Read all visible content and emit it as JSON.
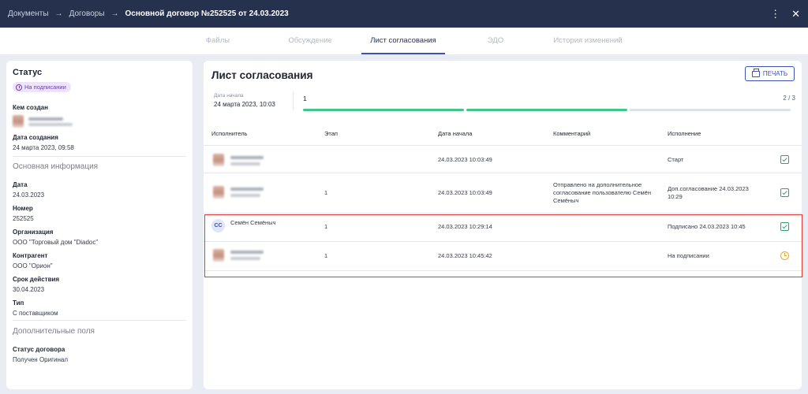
{
  "topbar": {
    "breadcrumbs": [
      "Документы",
      "Договоры"
    ],
    "current": "Основной договор №252525 от 24.03.2023",
    "separator": "→",
    "more_icon": "⋮",
    "close_icon": "✕"
  },
  "tabs": [
    "Файлы",
    "Обсуждение",
    "Лист согласования",
    "ЭДО",
    "История изменений"
  ],
  "active_tab": "Лист согласования",
  "left": {
    "status_title": "Статус",
    "status_badge": "На подписании",
    "created_by_label": "Кем создан",
    "created_date_label": "Дата создания",
    "created_date_value": "24 марта 2023, 09:58",
    "main_info_title": "Основная информация",
    "fields": [
      {
        "label": "Дата",
        "value": "24.03.2023"
      },
      {
        "label": "Номер",
        "value": "252525"
      },
      {
        "label": "Организация",
        "value": "ООО \"Торговый дом \"Diadoc\""
      },
      {
        "label": "Контрагент",
        "value": "ООО \"Орион\""
      },
      {
        "label": "Срок действия",
        "value": "30.04.2023"
      },
      {
        "label": "Тип",
        "value": "С поставщиком"
      }
    ],
    "extra_title": "Дополнительные поля",
    "extra_fields": [
      {
        "label": "Статус договора",
        "value": "Получен Оригинал"
      }
    ]
  },
  "sheet": {
    "title": "Лист согласования",
    "print_label": "ПЕЧАТЬ",
    "start_label": "Дата начала",
    "start_value": "24 марта 2023, 10:03",
    "step": "1",
    "step_count": "2 / 3",
    "progress_segments": [
      "done",
      "done",
      "pending"
    ],
    "columns": [
      "Исполнитель",
      "Этап",
      "Дата начала",
      "Комментарий",
      "Исполнение"
    ],
    "rows": [
      {
        "executor": "",
        "stage": "",
        "date": "24.03.2023 10:03:49",
        "comment": "",
        "result": "Старт",
        "status": "check"
      },
      {
        "executor": "",
        "stage": "1",
        "date": "24.03.2023 10:03:49",
        "comment": "Отправлено на дополнительное согласование пользователю Семён Семёныч",
        "result": "Доп.согласование 24.03.2023 10:29",
        "status": "check"
      },
      {
        "executor": "Семён Семёныч",
        "initials": "СС",
        "stage": "1",
        "date": "24.03.2023 10:29:14",
        "comment": "",
        "result": "Подписано 24.03.2023 10:45",
        "status": "check"
      },
      {
        "executor": "",
        "stage": "1",
        "date": "24.03.2023 10:45:42",
        "comment": "",
        "result": "На подписании",
        "status": "clock"
      }
    ]
  },
  "colors": {
    "topbar": "#26324d",
    "accent": "#3f51b5",
    "progress_done": "#43c58a",
    "progress_pending": "#dde1e8",
    "check": "#2ea66b",
    "clock": "#f2a81d",
    "highlight": "#e53935",
    "badge_bg": "#ede3fb",
    "badge_text": "#6b3fb0"
  },
  "icons": {
    "status_badge": "clock-icon",
    "print": "printer-icon",
    "executed": "check-icon",
    "pending": "clock-icon"
  }
}
